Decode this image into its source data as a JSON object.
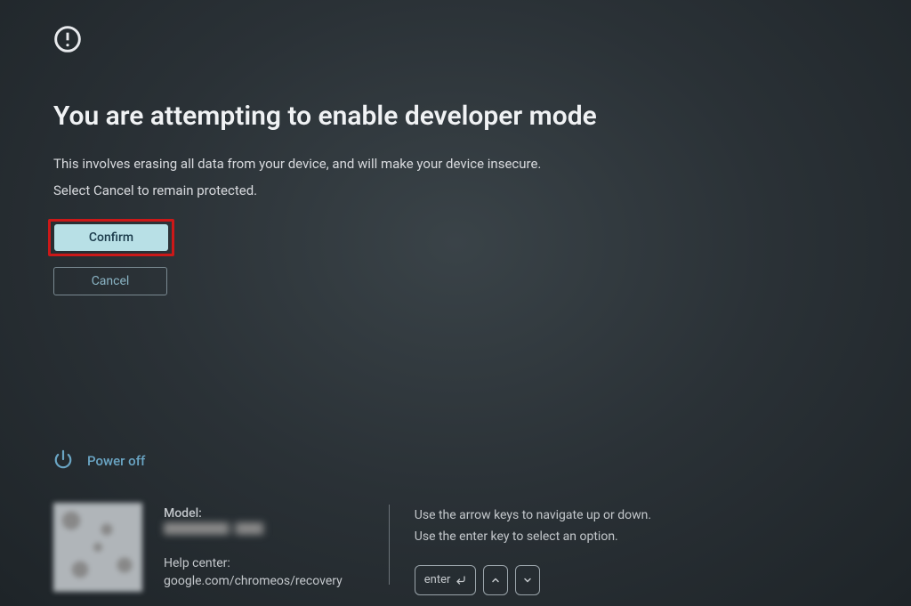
{
  "heading": "You are attempting to enable developer mode",
  "body": {
    "line1": "This involves erasing all data from your device, and will make your device insecure.",
    "line2": "Select Cancel to remain protected."
  },
  "buttons": {
    "confirm": "Confirm",
    "cancel": "Cancel"
  },
  "power": {
    "label": "Power off"
  },
  "footer": {
    "model_label": "Model:",
    "help_label": "Help center:",
    "help_url": "google.com/chromeos/recovery"
  },
  "instructions": {
    "line1": "Use the arrow keys to navigate up or down.",
    "line2": "Use the enter key to select an option."
  },
  "keys": {
    "enter": "enter"
  }
}
